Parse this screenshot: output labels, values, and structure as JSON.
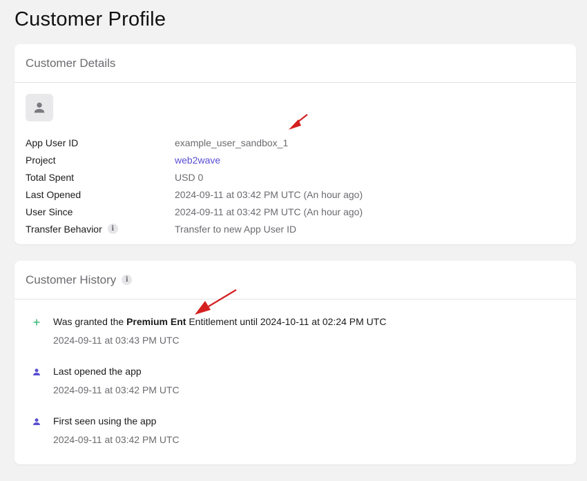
{
  "page": {
    "title": "Customer Profile"
  },
  "details": {
    "header": "Customer Details",
    "rows": [
      {
        "label": "App User ID",
        "value": "example_user_sandbox_1"
      },
      {
        "label": "Project",
        "value": "web2wave"
      },
      {
        "label": "Total Spent",
        "value": "USD 0"
      },
      {
        "label": "Last Opened",
        "value": "2024-09-11 at 03:42 PM UTC (An hour ago)"
      },
      {
        "label": "User Since",
        "value": "2024-09-11 at 03:42 PM UTC (An hour ago)"
      },
      {
        "label": "Transfer Behavior",
        "value": "Transfer to new App User ID"
      }
    ]
  },
  "history": {
    "header": "Customer History",
    "items": [
      {
        "icon": "plus-icon",
        "text_before": "Was granted the ",
        "text_bold": "Premium Ent",
        "text_after": " Entitlement until 2024-10-11 at 02:24 PM UTC",
        "time": "2024-09-11 at 03:43 PM UTC"
      },
      {
        "icon": "person-icon",
        "text": "Last opened the app",
        "time": "2024-09-11 at 03:42 PM UTC"
      },
      {
        "icon": "person-icon",
        "text": "First seen using the app",
        "time": "2024-09-11 at 03:42 PM UTC"
      }
    ]
  },
  "colors": {
    "accent": "#5a4fd1",
    "plus_icon": "#3cb878",
    "annotation_arrow": "#d42020",
    "muted_text": "#6b6b70",
    "background": "#f2f2f3"
  }
}
